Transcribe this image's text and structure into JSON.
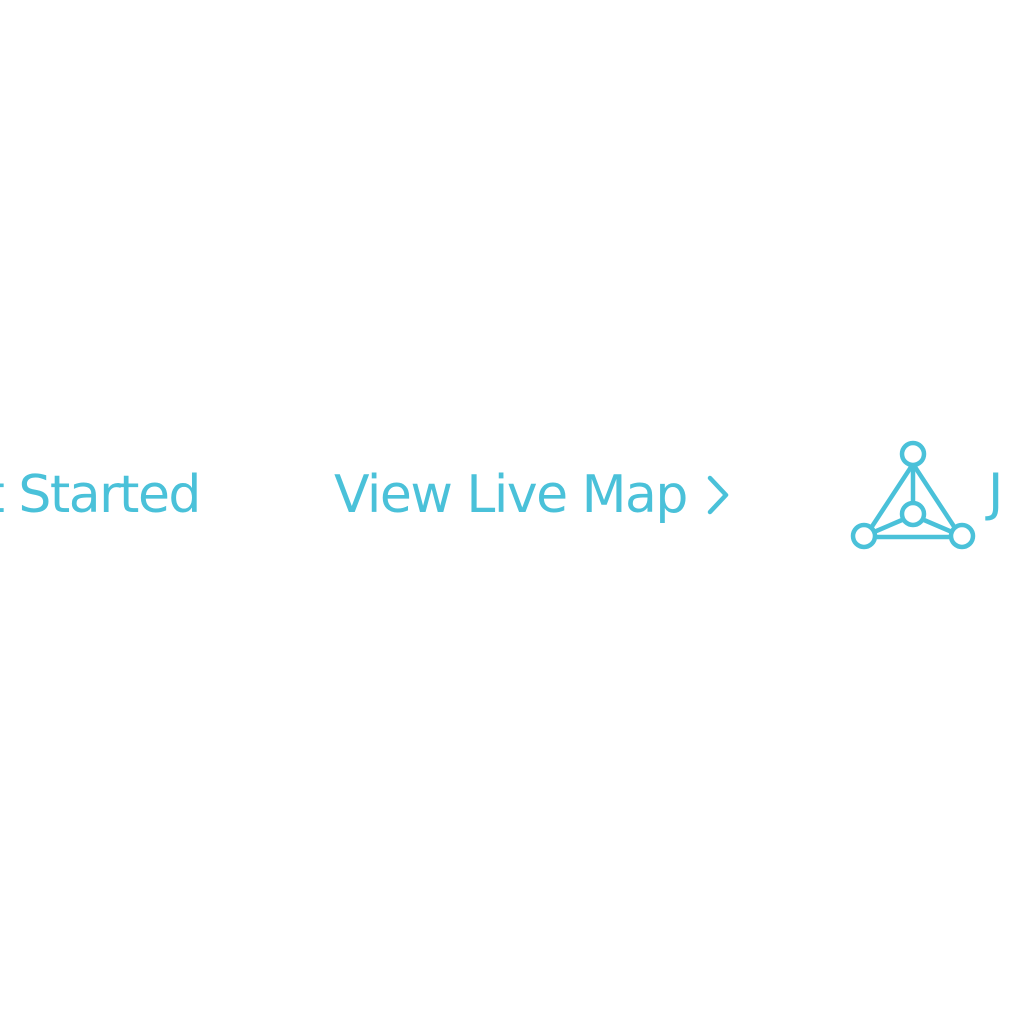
{
  "nav": {
    "get_started_label": "et Started",
    "view_live_map_label": "View Live Map",
    "network_label": "J"
  },
  "icons": {
    "view_live_map": "chevron-right-icon",
    "network": "network-triangle-icon"
  },
  "colors": {
    "accent": "#4ac1d9",
    "background": "#ffffff"
  }
}
